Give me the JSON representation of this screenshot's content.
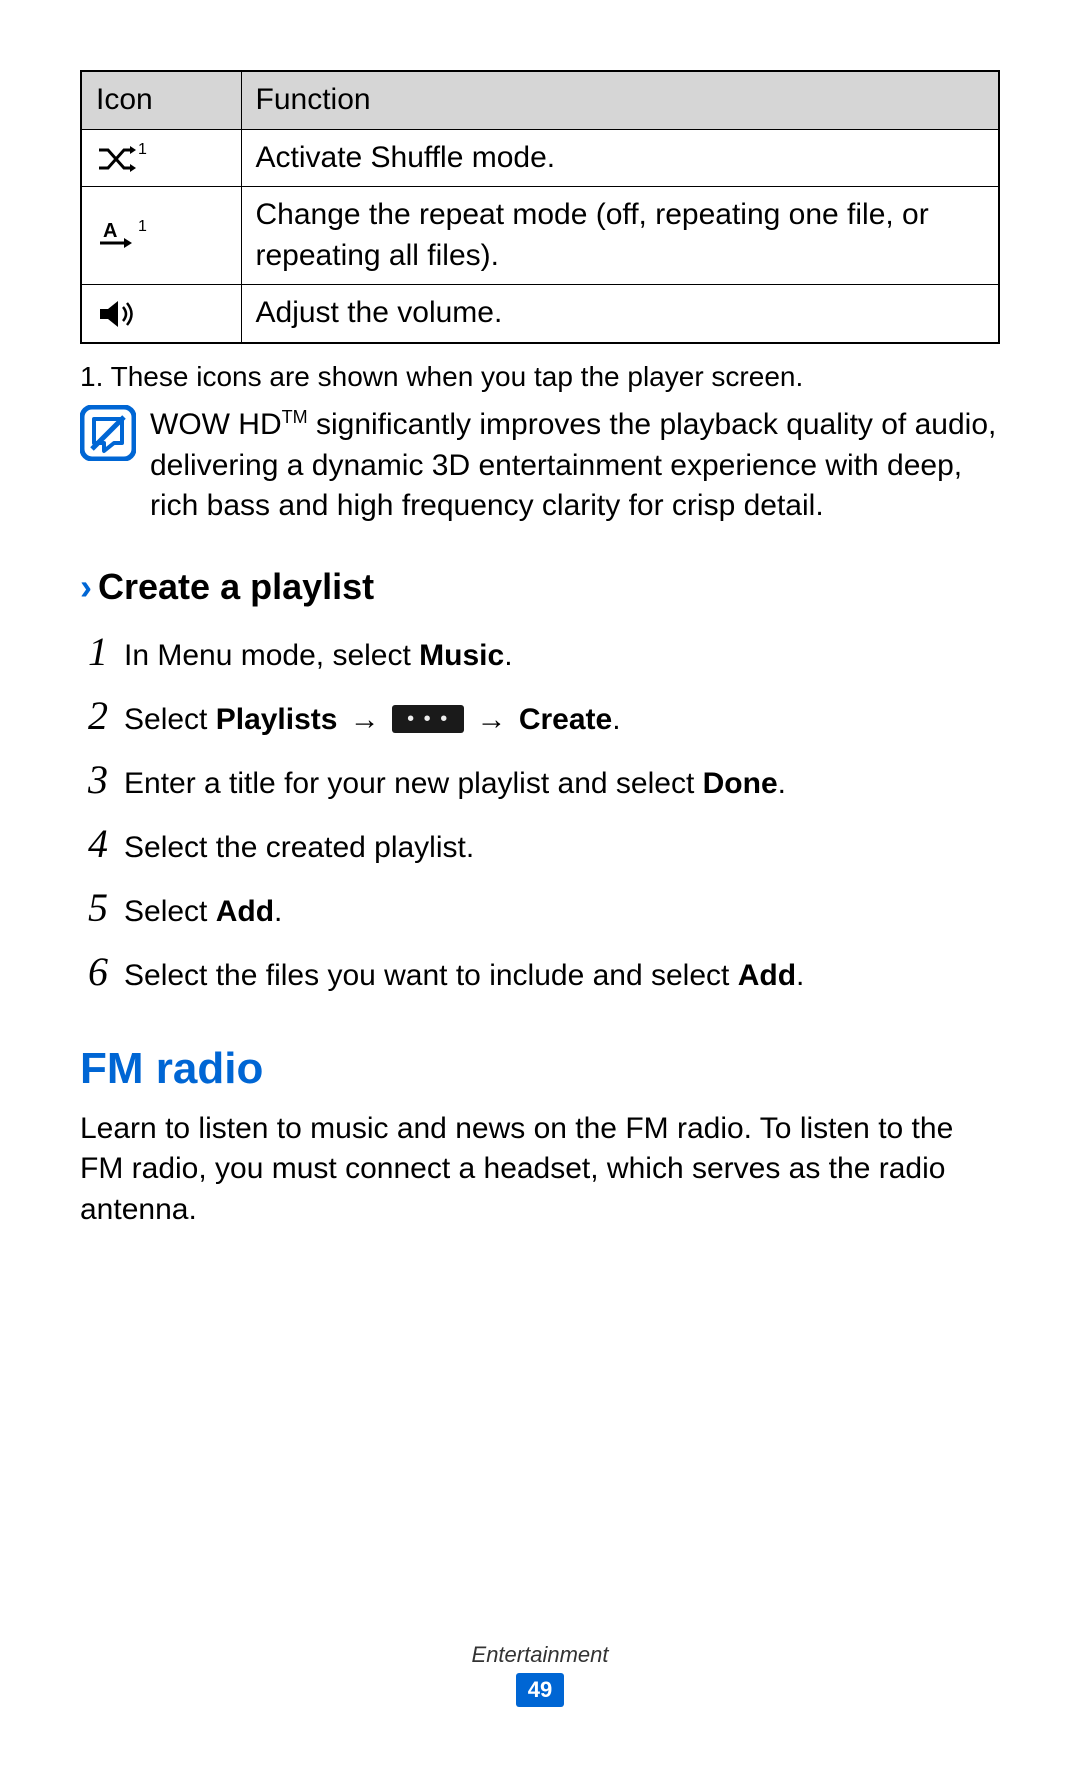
{
  "table": {
    "headers": {
      "icon": "Icon",
      "function": "Function"
    },
    "rows": [
      {
        "function": "Activate Shuffle mode.",
        "footnote_mark": "1"
      },
      {
        "function": "Change the repeat mode (off, repeating one file, or repeating all files).",
        "footnote_mark": "1"
      },
      {
        "function": "Adjust the volume."
      }
    ]
  },
  "footnote": "1.  These icons are shown when you tap the player screen.",
  "note": {
    "prefix": "WOW HD",
    "tm": "TM",
    "rest": " significantly improves the playback quality of audio, delivering a dynamic 3D entertainment experience with deep, rich bass and high frequency clarity for crisp detail."
  },
  "section_title": "Create a playlist",
  "steps": [
    {
      "n": "1",
      "pre": "In Menu mode, select ",
      "b1": "Music",
      "post": "."
    },
    {
      "n": "2",
      "pre": "Select ",
      "b1": "Playlists",
      "arrow1": " → ",
      "more_icon": true,
      "arrow2": " → ",
      "b2": "Create",
      "post": "."
    },
    {
      "n": "3",
      "pre": "Enter a title for your new playlist and select ",
      "b1": "Done",
      "post": "."
    },
    {
      "n": "4",
      "pre": "Select the created playlist."
    },
    {
      "n": "5",
      "pre": "Select ",
      "b1": "Add",
      "post": "."
    },
    {
      "n": "6",
      "pre": "Select the files you want to include and select ",
      "b1": "Add",
      "post": "."
    }
  ],
  "heading_blue": "FM radio",
  "body": "Learn to listen to music and news on the FM radio. To listen to the FM radio, you must connect a headset, which serves as the radio antenna.",
  "footer_section": "Entertainment",
  "page_number": "49"
}
